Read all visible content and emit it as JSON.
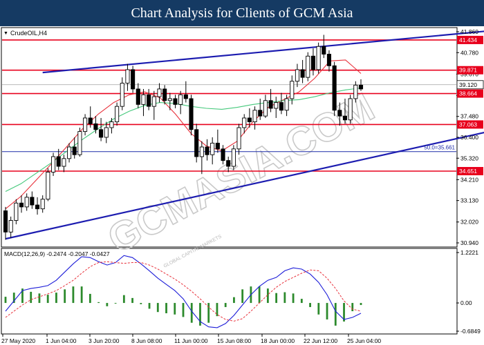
{
  "banner_title": "Chart Analysis for Clients of GCM Asia",
  "watermark": "GCMASIA.COM",
  "watermark_sub": "GLOBAL CAPITAL MARKETS",
  "chart_data": [
    {
      "type": "candlestick",
      "title": "CrudeOIL,H4",
      "timeframe": "H4",
      "ylim": [
        30.94,
        41.86
      ],
      "y_ticks": [
        41.86,
        40.78,
        39.67,
        38.56,
        37.48,
        36.4,
        35.32,
        34.21,
        33.13,
        32.02,
        30.94
      ],
      "x_tick_labels": [
        "27 May 2020",
        "1 Jun 04:00",
        "3 Jun 20:00",
        "8 Jun 08:00",
        "11 Jun 00:00",
        "15 Jun 08:00",
        "18 Jun 00:00",
        "22 Jun 12:00",
        "25 Jun 04:00"
      ],
      "horizontal_levels": [
        {
          "value": 41.434,
          "label": "41.434",
          "color": "#e8001c"
        },
        {
          "value": 39.871,
          "label": "39.871",
          "color": "#e8001c"
        },
        {
          "value": 38.664,
          "label": "38.664",
          "color": "#e8001c"
        },
        {
          "value": 37.063,
          "label": "37.063",
          "color": "#e8001c"
        },
        {
          "value": 35.661,
          "label": "50.0=35.661",
          "color": "#1c2aa8",
          "style": "fibonacci"
        },
        {
          "value": 34.651,
          "label": "34.651",
          "color": "#e8001c"
        }
      ],
      "current_price": 39.12,
      "trendlines": [
        {
          "from": [
            0,
            31.15
          ],
          "to": [
            110,
            37.85
          ]
        },
        {
          "from": [
            7,
            39.75
          ],
          "to": [
            91,
            41.9
          ]
        }
      ],
      "moving_averages": [
        {
          "color": "#e8303a",
          "values": [
            32.7,
            33.35,
            34.2,
            35.05,
            35.95,
            36.85,
            37.6,
            38.2,
            38.6,
            38.75,
            38.45,
            37.6,
            36.6,
            35.95,
            35.7,
            36.2,
            37.2,
            37.95,
            38.35,
            38.75,
            39.45,
            40.35,
            40.4,
            39.7
          ]
        },
        {
          "color": "#43c87a",
          "values": [
            33.6,
            34.0,
            34.55,
            35.1,
            35.7,
            36.3,
            36.85,
            37.35,
            37.75,
            38.05,
            38.2,
            38.15,
            38.0,
            37.9,
            37.85,
            37.95,
            38.1,
            38.2,
            38.3,
            38.35,
            38.5,
            38.7,
            38.85,
            38.95
          ]
        }
      ],
      "ma_points": 24,
      "candles_ohlc": [
        [
          32.6,
          32.8,
          31.1,
          31.5
        ],
        [
          31.5,
          32.3,
          31.2,
          32.1
        ],
        [
          32.1,
          33.2,
          31.9,
          33.0
        ],
        [
          33.0,
          33.4,
          32.5,
          32.8
        ],
        [
          32.8,
          33.5,
          32.6,
          33.3
        ],
        [
          33.3,
          33.6,
          32.7,
          32.9
        ],
        [
          32.9,
          33.3,
          32.4,
          32.7
        ],
        [
          32.7,
          33.4,
          32.5,
          33.2
        ],
        [
          33.2,
          34.8,
          33.1,
          34.6
        ],
        [
          34.6,
          35.6,
          34.4,
          35.4
        ],
        [
          35.4,
          35.8,
          34.7,
          34.9
        ],
        [
          34.9,
          35.5,
          34.6,
          35.3
        ],
        [
          35.3,
          36.1,
          35.1,
          35.9
        ],
        [
          35.9,
          36.4,
          35.3,
          35.5
        ],
        [
          35.5,
          36.9,
          35.4,
          36.7
        ],
        [
          36.7,
          37.6,
          36.5,
          37.4
        ],
        [
          37.4,
          38.0,
          36.9,
          37.1
        ],
        [
          37.1,
          37.5,
          36.6,
          36.8
        ],
        [
          36.8,
          37.4,
          36.2,
          36.4
        ],
        [
          36.4,
          37.2,
          36.1,
          36.9
        ],
        [
          36.9,
          37.4,
          36.6,
          37.2
        ],
        [
          37.2,
          38.2,
          37.0,
          38.0
        ],
        [
          38.0,
          39.5,
          37.8,
          39.2
        ],
        [
          39.2,
          40.2,
          38.8,
          39.9
        ],
        [
          39.9,
          40.1,
          38.7,
          38.9
        ],
        [
          38.9,
          39.2,
          37.9,
          38.1
        ],
        [
          38.1,
          38.9,
          37.5,
          38.6
        ],
        [
          38.6,
          38.9,
          37.8,
          38.0
        ],
        [
          38.0,
          38.8,
          37.3,
          38.5
        ],
        [
          38.5,
          39.2,
          38.2,
          38.9
        ],
        [
          38.9,
          39.1,
          38.1,
          38.3
        ],
        [
          38.3,
          38.7,
          37.8,
          38.4
        ],
        [
          38.4,
          38.6,
          37.9,
          38.1
        ],
        [
          38.1,
          38.8,
          37.6,
          38.6
        ],
        [
          38.6,
          39.3,
          38.2,
          38.4
        ],
        [
          38.4,
          38.6,
          36.5,
          36.8
        ],
        [
          36.8,
          37.1,
          35.1,
          35.4
        ],
        [
          35.4,
          36.2,
          34.5,
          35.9
        ],
        [
          35.9,
          36.3,
          35.2,
          35.5
        ],
        [
          35.5,
          36.4,
          35.0,
          36.1
        ],
        [
          36.1,
          36.8,
          35.6,
          35.8
        ],
        [
          35.8,
          36.0,
          35.0,
          35.2
        ],
        [
          35.2,
          35.4,
          34.6,
          34.9
        ],
        [
          34.9,
          36.0,
          34.7,
          35.8
        ],
        [
          35.8,
          37.1,
          35.5,
          36.9
        ],
        [
          36.9,
          37.6,
          36.6,
          37.4
        ],
        [
          37.4,
          37.9,
          36.9,
          37.2
        ],
        [
          37.2,
          38.0,
          36.8,
          37.8
        ],
        [
          37.8,
          38.4,
          37.3,
          37.5
        ],
        [
          37.5,
          38.6,
          37.4,
          38.3
        ],
        [
          38.3,
          38.9,
          37.7,
          37.9
        ],
        [
          37.9,
          38.5,
          37.4,
          38.2
        ],
        [
          38.2,
          38.7,
          37.6,
          37.8
        ],
        [
          37.8,
          38.6,
          37.5,
          38.4
        ],
        [
          38.4,
          39.6,
          38.1,
          39.3
        ],
        [
          39.3,
          40.2,
          39.0,
          39.9
        ],
        [
          39.9,
          40.4,
          39.2,
          39.5
        ],
        [
          39.5,
          40.8,
          39.3,
          40.6
        ],
        [
          40.6,
          41.0,
          39.6,
          39.9
        ],
        [
          39.9,
          41.3,
          39.7,
          41.1
        ],
        [
          41.1,
          41.7,
          40.5,
          40.7
        ],
        [
          40.7,
          40.9,
          39.8,
          40.1
        ],
        [
          40.1,
          40.3,
          37.5,
          37.8
        ],
        [
          37.8,
          38.2,
          37.0,
          37.5
        ],
        [
          37.5,
          38.4,
          37.1,
          37.3
        ],
        [
          37.3,
          38.6,
          37.1,
          38.4
        ],
        [
          38.4,
          39.3,
          38.2,
          39.1
        ],
        [
          39.1,
          39.4,
          38.8,
          38.9
        ]
      ]
    },
    {
      "type": "macd",
      "title": "MACD(12,26,9) -0.2474 -0.2047 -0.0427",
      "params": [
        12,
        26,
        9
      ],
      "values": {
        "macd": -0.2474,
        "signal": -0.2047,
        "histogram": -0.0427
      },
      "ylim": [
        -0.6849,
        1.2221
      ],
      "y_ticks": [
        1.2221,
        0.0,
        -0.6849
      ],
      "macd_line": [
        -0.2,
        0.05,
        0.3,
        0.35,
        0.38,
        0.42,
        0.55,
        0.75,
        0.95,
        1.12,
        1.1,
        1.0,
        0.92,
        0.98,
        1.15,
        1.1,
        0.95,
        0.78,
        0.6,
        0.45,
        0.3,
        0.1,
        -0.2,
        -0.45,
        -0.58,
        -0.6,
        -0.5,
        -0.3,
        -0.05,
        0.2,
        0.4,
        0.55,
        0.62,
        0.78,
        0.85,
        0.82,
        0.7,
        0.5,
        0.2,
        -0.2,
        -0.4,
        -0.35,
        -0.25
      ],
      "signal_line": [
        -0.35,
        -0.2,
        -0.05,
        0.08,
        0.15,
        0.22,
        0.3,
        0.42,
        0.55,
        0.72,
        0.88,
        0.98,
        1.0,
        0.98,
        0.96,
        0.98,
        0.98,
        0.92,
        0.82,
        0.7,
        0.58,
        0.44,
        0.28,
        0.1,
        -0.1,
        -0.28,
        -0.4,
        -0.44,
        -0.38,
        -0.2,
        0.0,
        0.2,
        0.38,
        0.52,
        0.62,
        0.72,
        0.8,
        0.78,
        0.6,
        0.35,
        0.05,
        -0.15,
        -0.2
      ],
      "histogram": [
        0.15,
        0.25,
        0.35,
        0.27,
        0.23,
        0.2,
        0.25,
        0.33,
        0.4,
        0.4,
        0.22,
        0.02,
        -0.08,
        0.0,
        0.19,
        0.12,
        -0.03,
        -0.14,
        -0.22,
        -0.25,
        -0.28,
        -0.34,
        -0.48,
        -0.55,
        -0.48,
        -0.32,
        -0.1,
        0.14,
        0.33,
        0.4,
        0.4,
        0.35,
        0.24,
        0.26,
        0.23,
        0.1,
        -0.1,
        -0.28,
        -0.4,
        -0.55,
        -0.45,
        -0.2,
        -0.05
      ]
    }
  ]
}
